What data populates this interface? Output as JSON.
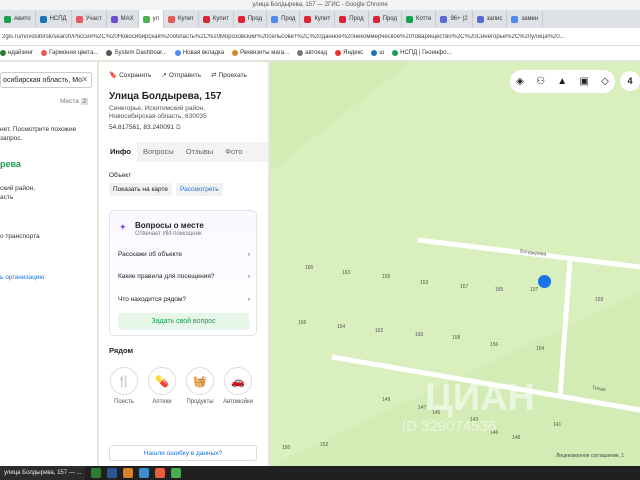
{
  "browser": {
    "window_title": "улица Болдырева, 157 — 2ГИС - Google Chrome",
    "tabs": [
      "Авито",
      "НСПД",
      "Участ",
      "MAX",
      "ул",
      "Купит",
      "Купит",
      "Прод",
      "Прод",
      "Купит",
      "Прод",
      "Прод",
      "Котте",
      "96+ (2",
      "запис",
      "замен"
    ],
    "active_tab": 4,
    "address": "2gis.ru/novosibirsk/search/Россия%2C%20Новосибирская%20область%2C%20Морозовский%20сельсовет%2C%20данное%20некоммерческое%20товарищество%2C%20Синегорье%2C%20улица%20...",
    "bookmarks": [
      "ндайзинг",
      "Гармония цвета...",
      "System Dashboar...",
      "Новая вкладка",
      "Реквизиты мага...",
      "автокад",
      "Яндекс",
      "ш",
      "НСПД | Геоинфо..."
    ]
  },
  "left_panel": {
    "search_value": "осибирская область, Мо",
    "places_label": "Места",
    "places_count": "2",
    "lines": [
      "нет. Посмотрите похожие",
      "запрос.",
      "рева",
      "ский район,",
      "асть",
      "о транспорта",
      "ь организацию"
    ]
  },
  "card": {
    "actions": [
      "Сохранить",
      "Отправить",
      "Проехать"
    ],
    "title": "Улица Болдырева, 157",
    "address_lines": [
      "Синегорье, Искитимский район,",
      "Новосибирская область,  630035"
    ],
    "coordinates": "54.817561, 83.240091",
    "tabs": [
      "Инфо",
      "Вопросы",
      "Отзывы",
      "Фото"
    ],
    "object_label": "Объект",
    "show_on_map": "Показать на карте",
    "consider": "Рассмотреть",
    "questions_title": "Вопросы о месте",
    "questions_sub": "Отвечает ИИ-помощник",
    "questions": [
      "Расскажи об объекте",
      "Какие правила для посещения?",
      "Что находится рядом?"
    ],
    "ask_button": "Задать свой вопрос",
    "nearby_label": "Рядом",
    "nearby": [
      "Поесть",
      "Аптеки",
      "Продукты",
      "Автомойки"
    ],
    "report_error": "Нашли ошибку в данных?"
  },
  "map": {
    "counter": "4",
    "street_names": [
      "Болдырева",
      "Тихая"
    ],
    "lot_labels": [
      "165",
      "163",
      "155",
      "153",
      "167",
      "165",
      "157",
      "159",
      "166",
      "164",
      "162",
      "160",
      "158",
      "156",
      "154",
      "149",
      "147",
      "145",
      "143",
      "146",
      "148",
      "150",
      "152",
      "141"
    ],
    "watermark": "ЦИАН",
    "watermark_id": "ID 329074536",
    "license": "Лицензионное соглашение, 1"
  },
  "taskbar": {
    "app": "улица Болдырева, 157 — ..."
  }
}
